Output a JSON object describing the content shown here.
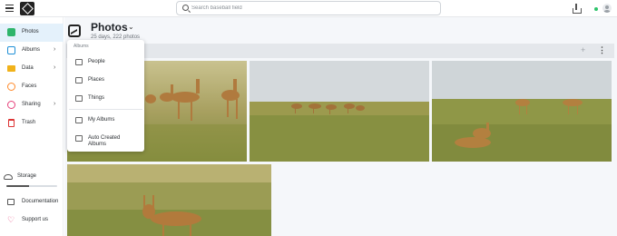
{
  "topbar": {
    "search_placeholder": "Search baseball field"
  },
  "sidebar": {
    "items": [
      {
        "label": "Photos",
        "icon": "photos-icon",
        "color": "#2fb56b",
        "active": true,
        "has_submenu": false
      },
      {
        "label": "Albums",
        "icon": "albums-icon",
        "color": "#1f8fd6",
        "active": false,
        "has_submenu": true
      },
      {
        "label": "Data",
        "icon": "data-icon",
        "color": "#f1b21a",
        "active": false,
        "has_submenu": true
      },
      {
        "label": "Faces",
        "icon": "faces-icon",
        "color": "#ff8a2a",
        "active": false,
        "has_submenu": false
      },
      {
        "label": "Sharing",
        "icon": "sharing-icon",
        "color": "#e5417b",
        "active": false,
        "has_submenu": true
      },
      {
        "label": "Trash",
        "icon": "trash-icon",
        "color": "#dd3333",
        "active": false,
        "has_submenu": false
      }
    ],
    "storage_label": "Storage",
    "storage_used_fraction": 0.45,
    "documentation_label": "Documentation",
    "support_label": "Support us"
  },
  "main": {
    "title": "Photos",
    "subtitle": "25 days, 222 photos"
  },
  "albums_menu": {
    "header": "Albums",
    "items": [
      {
        "label": "People",
        "icon": "people-icon"
      },
      {
        "label": "Places",
        "icon": "map-icon"
      },
      {
        "label": "Things",
        "icon": "tag-icon"
      },
      {
        "label": "My Albums",
        "icon": "bookmark-icon"
      },
      {
        "label": "Auto Created Albums",
        "icon": "auto-album-icon"
      }
    ]
  },
  "colors": {
    "accent": "#1f8fd6",
    "active_nav_bg": "#e4f1fb",
    "online_status": "#2ec46b"
  }
}
